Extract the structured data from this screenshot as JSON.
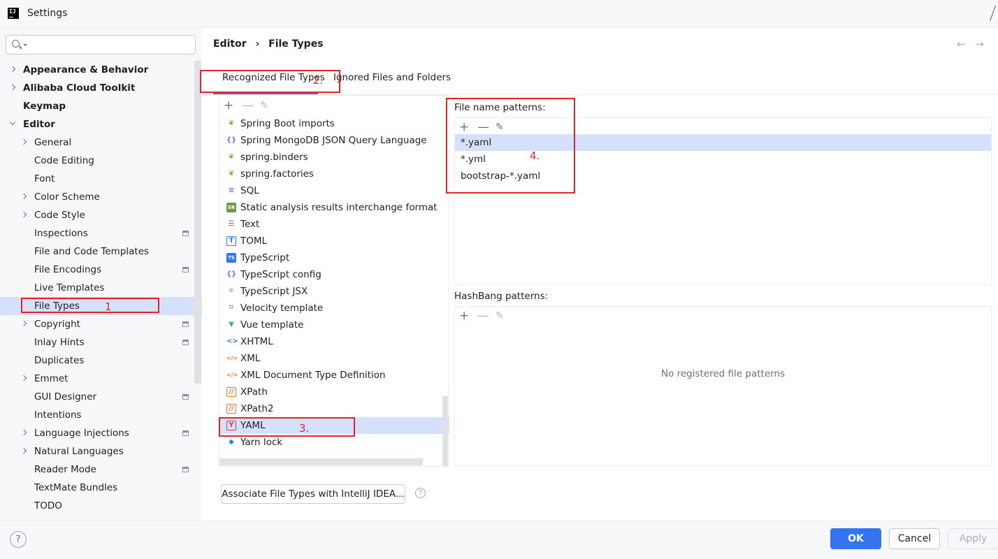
{
  "window": {
    "title": "Settings",
    "app_icon_text": "IJ"
  },
  "search": {
    "placeholder": ""
  },
  "sidebar": {
    "items": [
      {
        "label": "Appearance & Behavior",
        "level": 0,
        "bold": true,
        "expander": "collapsed"
      },
      {
        "label": "Alibaba Cloud Toolkit",
        "level": 0,
        "bold": true,
        "expander": "collapsed"
      },
      {
        "label": "Keymap",
        "level": 0,
        "bold": true,
        "expander": "none"
      },
      {
        "label": "Editor",
        "level": 0,
        "bold": true,
        "expander": "expanded"
      },
      {
        "label": "General",
        "level": 1,
        "expander": "collapsed"
      },
      {
        "label": "Code Editing",
        "level": 1,
        "expander": "none"
      },
      {
        "label": "Font",
        "level": 1,
        "expander": "none"
      },
      {
        "label": "Color Scheme",
        "level": 1,
        "expander": "collapsed"
      },
      {
        "label": "Code Style",
        "level": 1,
        "expander": "collapsed"
      },
      {
        "label": "Inspections",
        "level": 1,
        "expander": "none",
        "project": true
      },
      {
        "label": "File and Code Templates",
        "level": 1,
        "expander": "none"
      },
      {
        "label": "File Encodings",
        "level": 1,
        "expander": "none",
        "project": true
      },
      {
        "label": "Live Templates",
        "level": 1,
        "expander": "none"
      },
      {
        "label": "File Types",
        "level": 1,
        "expander": "none",
        "selected": true
      },
      {
        "label": "Copyright",
        "level": 1,
        "expander": "collapsed",
        "project": true
      },
      {
        "label": "Inlay Hints",
        "level": 1,
        "expander": "none",
        "project": true
      },
      {
        "label": "Duplicates",
        "level": 1,
        "expander": "none"
      },
      {
        "label": "Emmet",
        "level": 1,
        "expander": "collapsed"
      },
      {
        "label": "GUI Designer",
        "level": 1,
        "expander": "none",
        "project": true
      },
      {
        "label": "Intentions",
        "level": 1,
        "expander": "none"
      },
      {
        "label": "Language Injections",
        "level": 1,
        "expander": "collapsed",
        "project": true
      },
      {
        "label": "Natural Languages",
        "level": 1,
        "expander": "collapsed"
      },
      {
        "label": "Reader Mode",
        "level": 1,
        "expander": "none",
        "project": true
      },
      {
        "label": "TextMate Bundles",
        "level": 1,
        "expander": "none"
      },
      {
        "label": "TODO",
        "level": 1,
        "expander": "none"
      }
    ]
  },
  "breadcrumb": {
    "parent": "Editor",
    "separator": "›",
    "current": "File Types"
  },
  "tabs": [
    {
      "label": "Recognized File Types",
      "active": true
    },
    {
      "label": "Ignored Files and Folders",
      "active": false
    }
  ],
  "file_types": [
    {
      "label": "Spring Boot imports",
      "icon": "spring-leaf-icon"
    },
    {
      "label": "Spring MongoDB JSON Query Language",
      "icon": "json-braces-icon"
    },
    {
      "label": "spring.binders",
      "icon": "spring-leaf-icon"
    },
    {
      "label": "spring.factories",
      "icon": "spring-leaf-icon"
    },
    {
      "label": "SQL",
      "icon": "database-icon"
    },
    {
      "label": "Static analysis results interchange format",
      "icon": "sarif-icon"
    },
    {
      "label": "Text",
      "icon": "text-lines-icon"
    },
    {
      "label": "TOML",
      "icon": "toml-icon"
    },
    {
      "label": "TypeScript",
      "icon": "typescript-icon"
    },
    {
      "label": "TypeScript config",
      "icon": "json-braces-icon"
    },
    {
      "label": "TypeScript JSX",
      "icon": "react-icon"
    },
    {
      "label": "Velocity template",
      "icon": "velocity-icon"
    },
    {
      "label": "Vue template",
      "icon": "vue-icon"
    },
    {
      "label": "XHTML",
      "icon": "xhtml-icon"
    },
    {
      "label": "XML",
      "icon": "xml-icon"
    },
    {
      "label": "XML Document Type Definition",
      "icon": "xml-icon"
    },
    {
      "label": "XPath",
      "icon": "xpath-icon"
    },
    {
      "label": "XPath2",
      "icon": "xpath-icon"
    },
    {
      "label": "YAML",
      "icon": "yaml-icon",
      "selected": true
    },
    {
      "label": "Yarn lock",
      "icon": "yarn-icon"
    }
  ],
  "file_name_patterns": {
    "label": "File name patterns:",
    "items": [
      {
        "value": "*.yaml",
        "selected": true
      },
      {
        "value": "*.yml"
      },
      {
        "value": "bootstrap-*.yaml"
      }
    ]
  },
  "hashbang_patterns": {
    "label": "HashBang patterns:",
    "empty_text": "No registered file patterns"
  },
  "associate_button": "Associate File Types with IntelliJ IDEA...",
  "annotations": [
    "1",
    "2.",
    "3.",
    "4."
  ],
  "footer": {
    "ok": "OK",
    "cancel": "Cancel",
    "apply": "Apply"
  },
  "colors": {
    "accent": "#3574f0",
    "selection": "#d5e1fb",
    "annotation": "#e0252a"
  }
}
